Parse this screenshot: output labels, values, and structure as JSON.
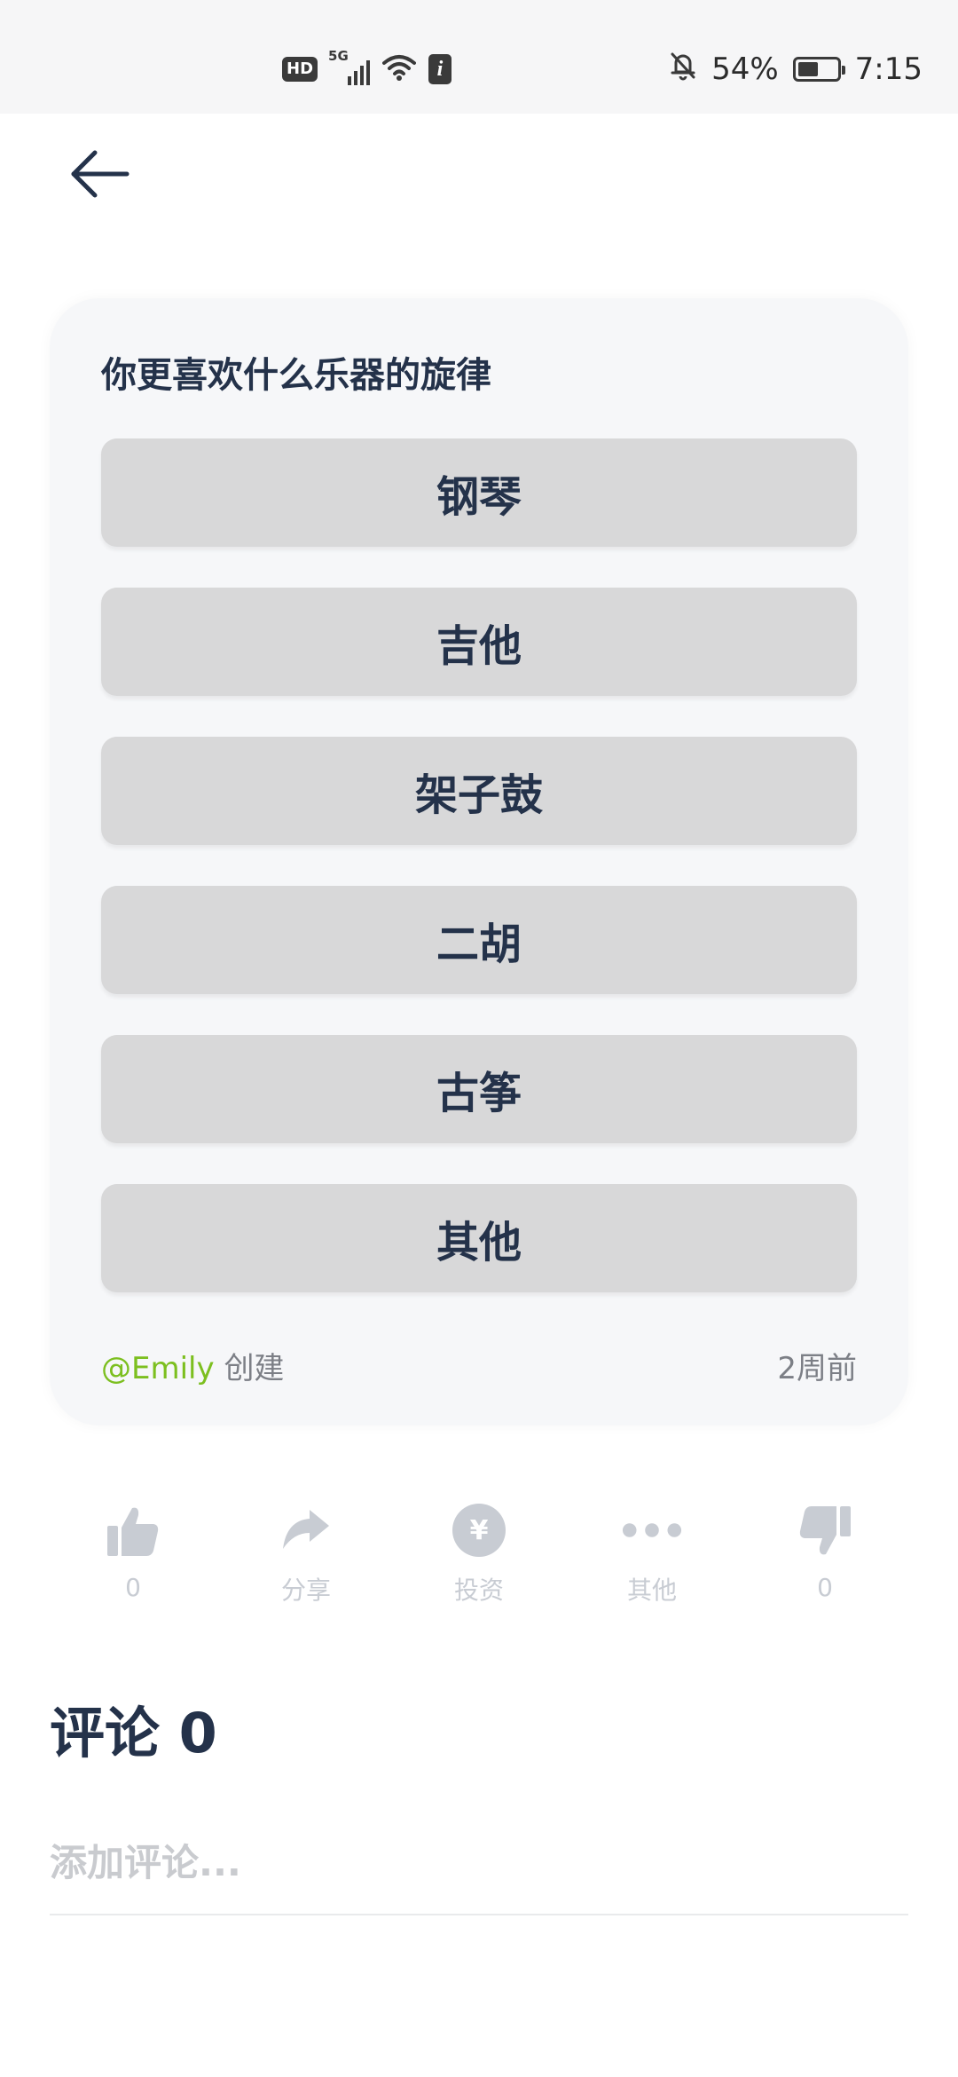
{
  "status_bar": {
    "hd": "HD",
    "network": "5G",
    "info": "i",
    "battery_percent": "54%",
    "battery_level": 0.54,
    "time": "7:15"
  },
  "poll": {
    "question": "你更喜欢什么乐器的旋律",
    "options": [
      "钢琴",
      "吉他",
      "架子鼓",
      "二胡",
      "古筝",
      "其他"
    ],
    "creator": "@Emily",
    "created_label": "创建",
    "time_ago": "2周前"
  },
  "actions": {
    "like_count": "0",
    "share_label": "分享",
    "invest_symbol": "¥",
    "invest_label": "投资",
    "more_label": "其他",
    "dislike_count": "0"
  },
  "comments": {
    "title": "评论 0",
    "placeholder": "添加评论..."
  },
  "colors": {
    "accent_green": "#7cbf1f",
    "text_dark": "#24324a",
    "icon_gray": "#c8ccd3",
    "option_bg": "#d8d8d9"
  }
}
